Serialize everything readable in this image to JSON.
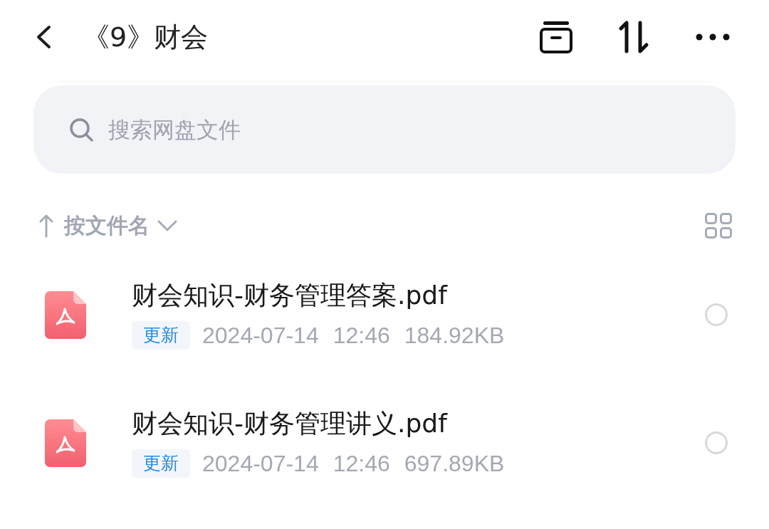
{
  "header": {
    "title": "《9》财会"
  },
  "search": {
    "placeholder": "搜索网盘文件"
  },
  "sort_bar": {
    "label": "按文件名"
  },
  "files": [
    {
      "name": "财会知识-财务管理答案.pdf",
      "badge": "更新",
      "date": "2024-07-14",
      "time": "12:46",
      "size": "184.92KB",
      "selected": false
    },
    {
      "name": "财会知识-财务管理讲义.pdf",
      "badge": "更新",
      "date": "2024-07-14",
      "time": "12:46",
      "size": "697.89KB",
      "selected": false
    }
  ]
}
